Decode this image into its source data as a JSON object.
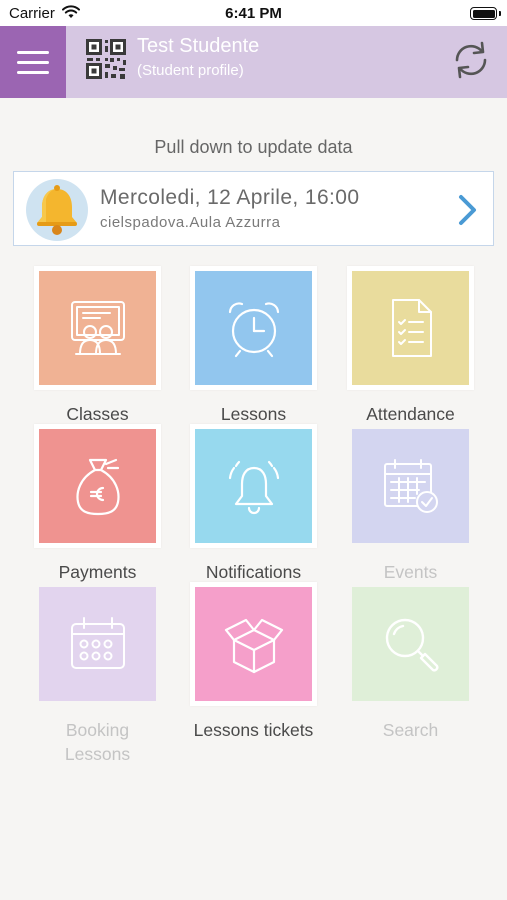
{
  "status": {
    "carrier": "Carrier",
    "time": "6:41 PM"
  },
  "header": {
    "name": "Test Studente",
    "subtitle": "(Student profile)"
  },
  "hint": "Pull down to update data",
  "next_lesson": {
    "date": "Mercoledi, 12 Aprile, 16:00",
    "location": "cielspadova.Aula Azzurra"
  },
  "tiles": [
    {
      "label": "Classes",
      "color": "#f0b294",
      "icon": "classroom-icon",
      "enabled": true
    },
    {
      "label": "Lessons",
      "color": "#92c6ee",
      "icon": "alarm-clock-icon",
      "enabled": true
    },
    {
      "label": "Attendance",
      "color": "#e9dc9d",
      "icon": "checklist-icon",
      "enabled": true
    },
    {
      "label": "Payments",
      "color": "#ef9390",
      "icon": "money-bag-icon",
      "enabled": true
    },
    {
      "label": "Notifications",
      "color": "#97d9ee",
      "icon": "bell-icon",
      "enabled": true
    },
    {
      "label": "Events",
      "color": "#d3d5f0",
      "icon": "calendar-check-icon",
      "enabled": false
    },
    {
      "label": "Booking Lessons",
      "color": "#e2d4ee",
      "icon": "calendar-icon",
      "enabled": false
    },
    {
      "label": "Lessons tickets",
      "color": "#f59fca",
      "icon": "box-icon",
      "enabled": true
    },
    {
      "label": "Search",
      "color": "#dfefd8",
      "icon": "magnifier-icon",
      "enabled": false
    }
  ],
  "colors": {
    "menu": "#9b65b2",
    "header": "#d6c7e2",
    "background": "#f6f5f3",
    "chevron": "#4a9ad4"
  }
}
